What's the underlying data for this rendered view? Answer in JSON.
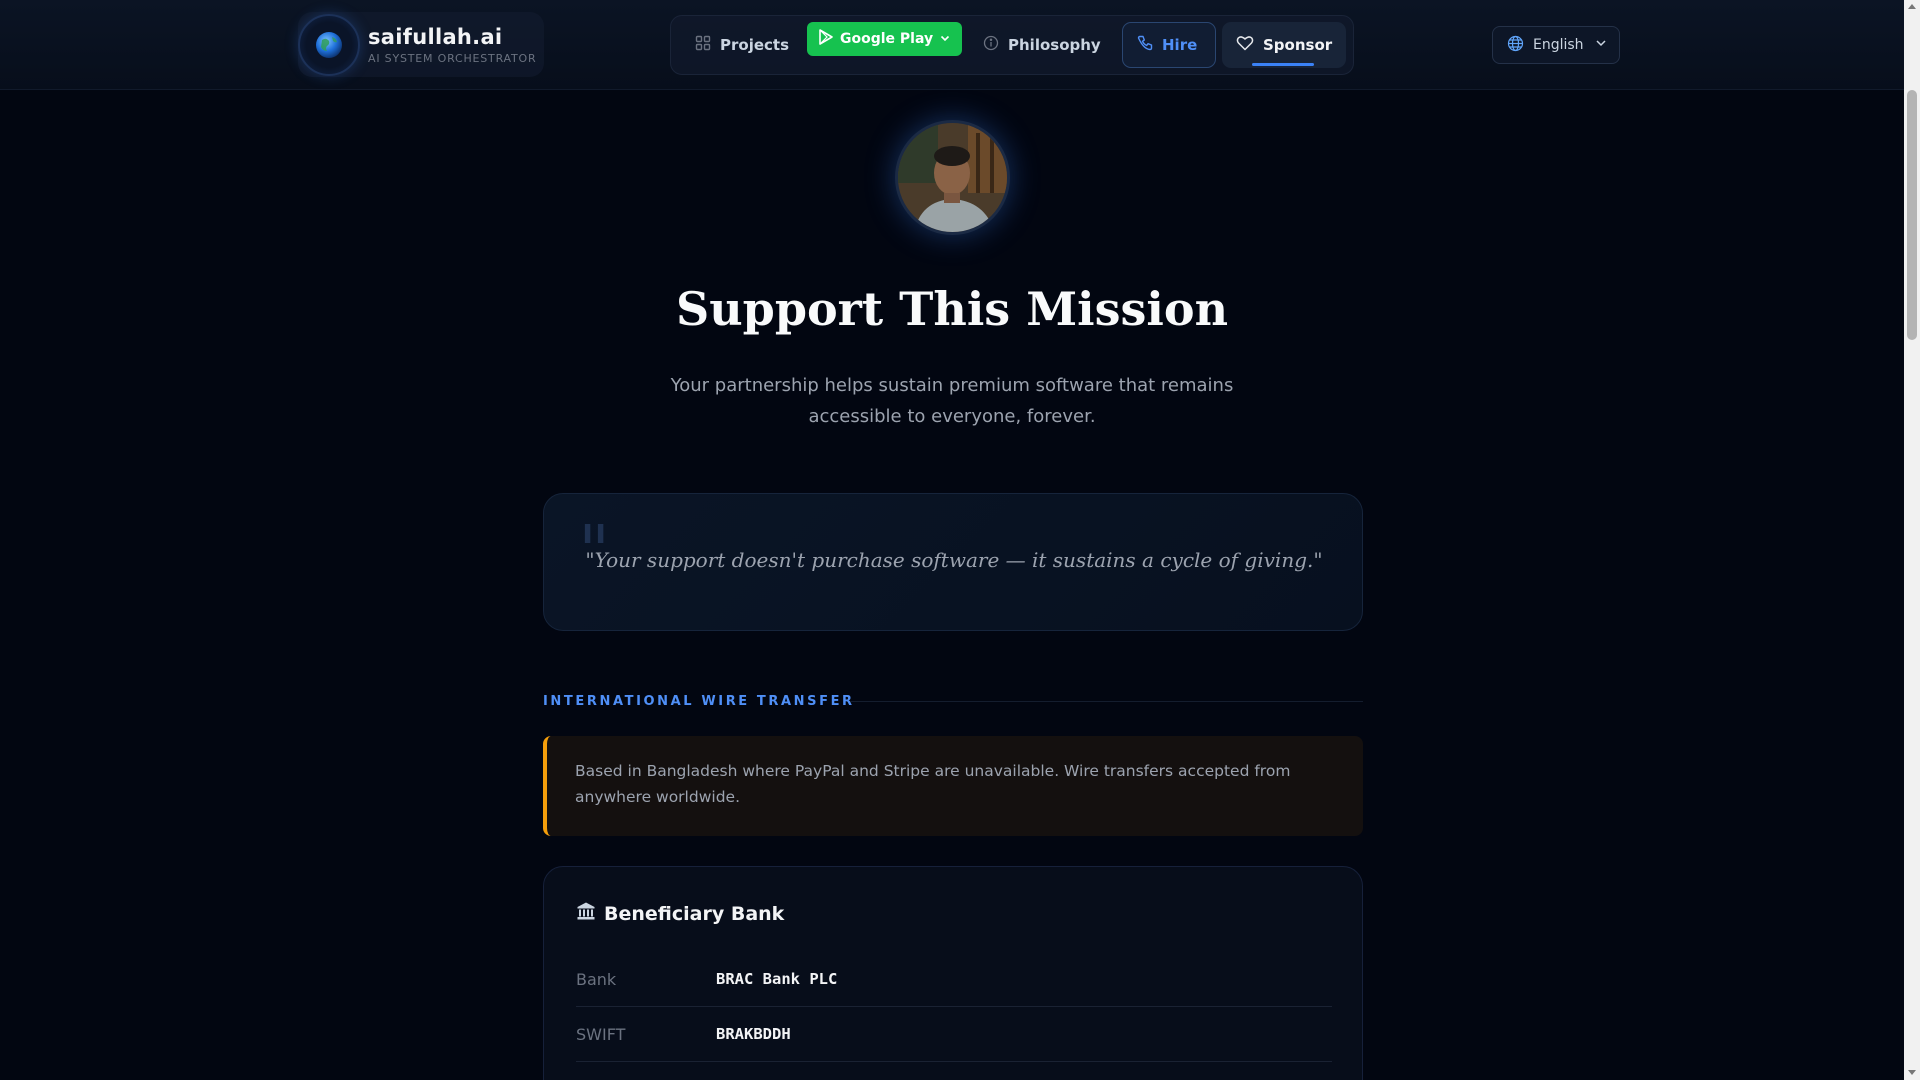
{
  "header": {
    "brand_name": "saifullah.ai",
    "brand_tagline": "AI SYSTEM ORCHESTRATOR",
    "nav": {
      "projects": "Projects",
      "google_play": "Google Play",
      "philosophy": "Philosophy",
      "hire": "Hire",
      "sponsor": "Sponsor"
    },
    "language": "English",
    "active_tab": "Sponsor",
    "colors": {
      "accent": "#3b82f6",
      "google_play": "#16c24f"
    }
  },
  "hero": {
    "title": "Support This Mission",
    "subtitle": "Your partnership helps sustain premium software that remains accessible to everyone, forever."
  },
  "quote": {
    "text": "\"Your support doesn't purchase software — it sustains a cycle of giving.\""
  },
  "wire": {
    "heading": "INTERNATIONAL WIRE TRANSFER",
    "notice": "Based in Bangladesh where PayPal and Stripe are unavailable. Wire transfers accepted from anywhere worldwide.",
    "notice_color": "#f59e0b"
  },
  "bank": {
    "title": "Beneficiary Bank",
    "icon": "bank-icon",
    "rows": [
      {
        "label": "Bank",
        "value": "BRAC Bank PLC"
      },
      {
        "label": "SWIFT",
        "value": "BRAKBDDH"
      }
    ]
  }
}
